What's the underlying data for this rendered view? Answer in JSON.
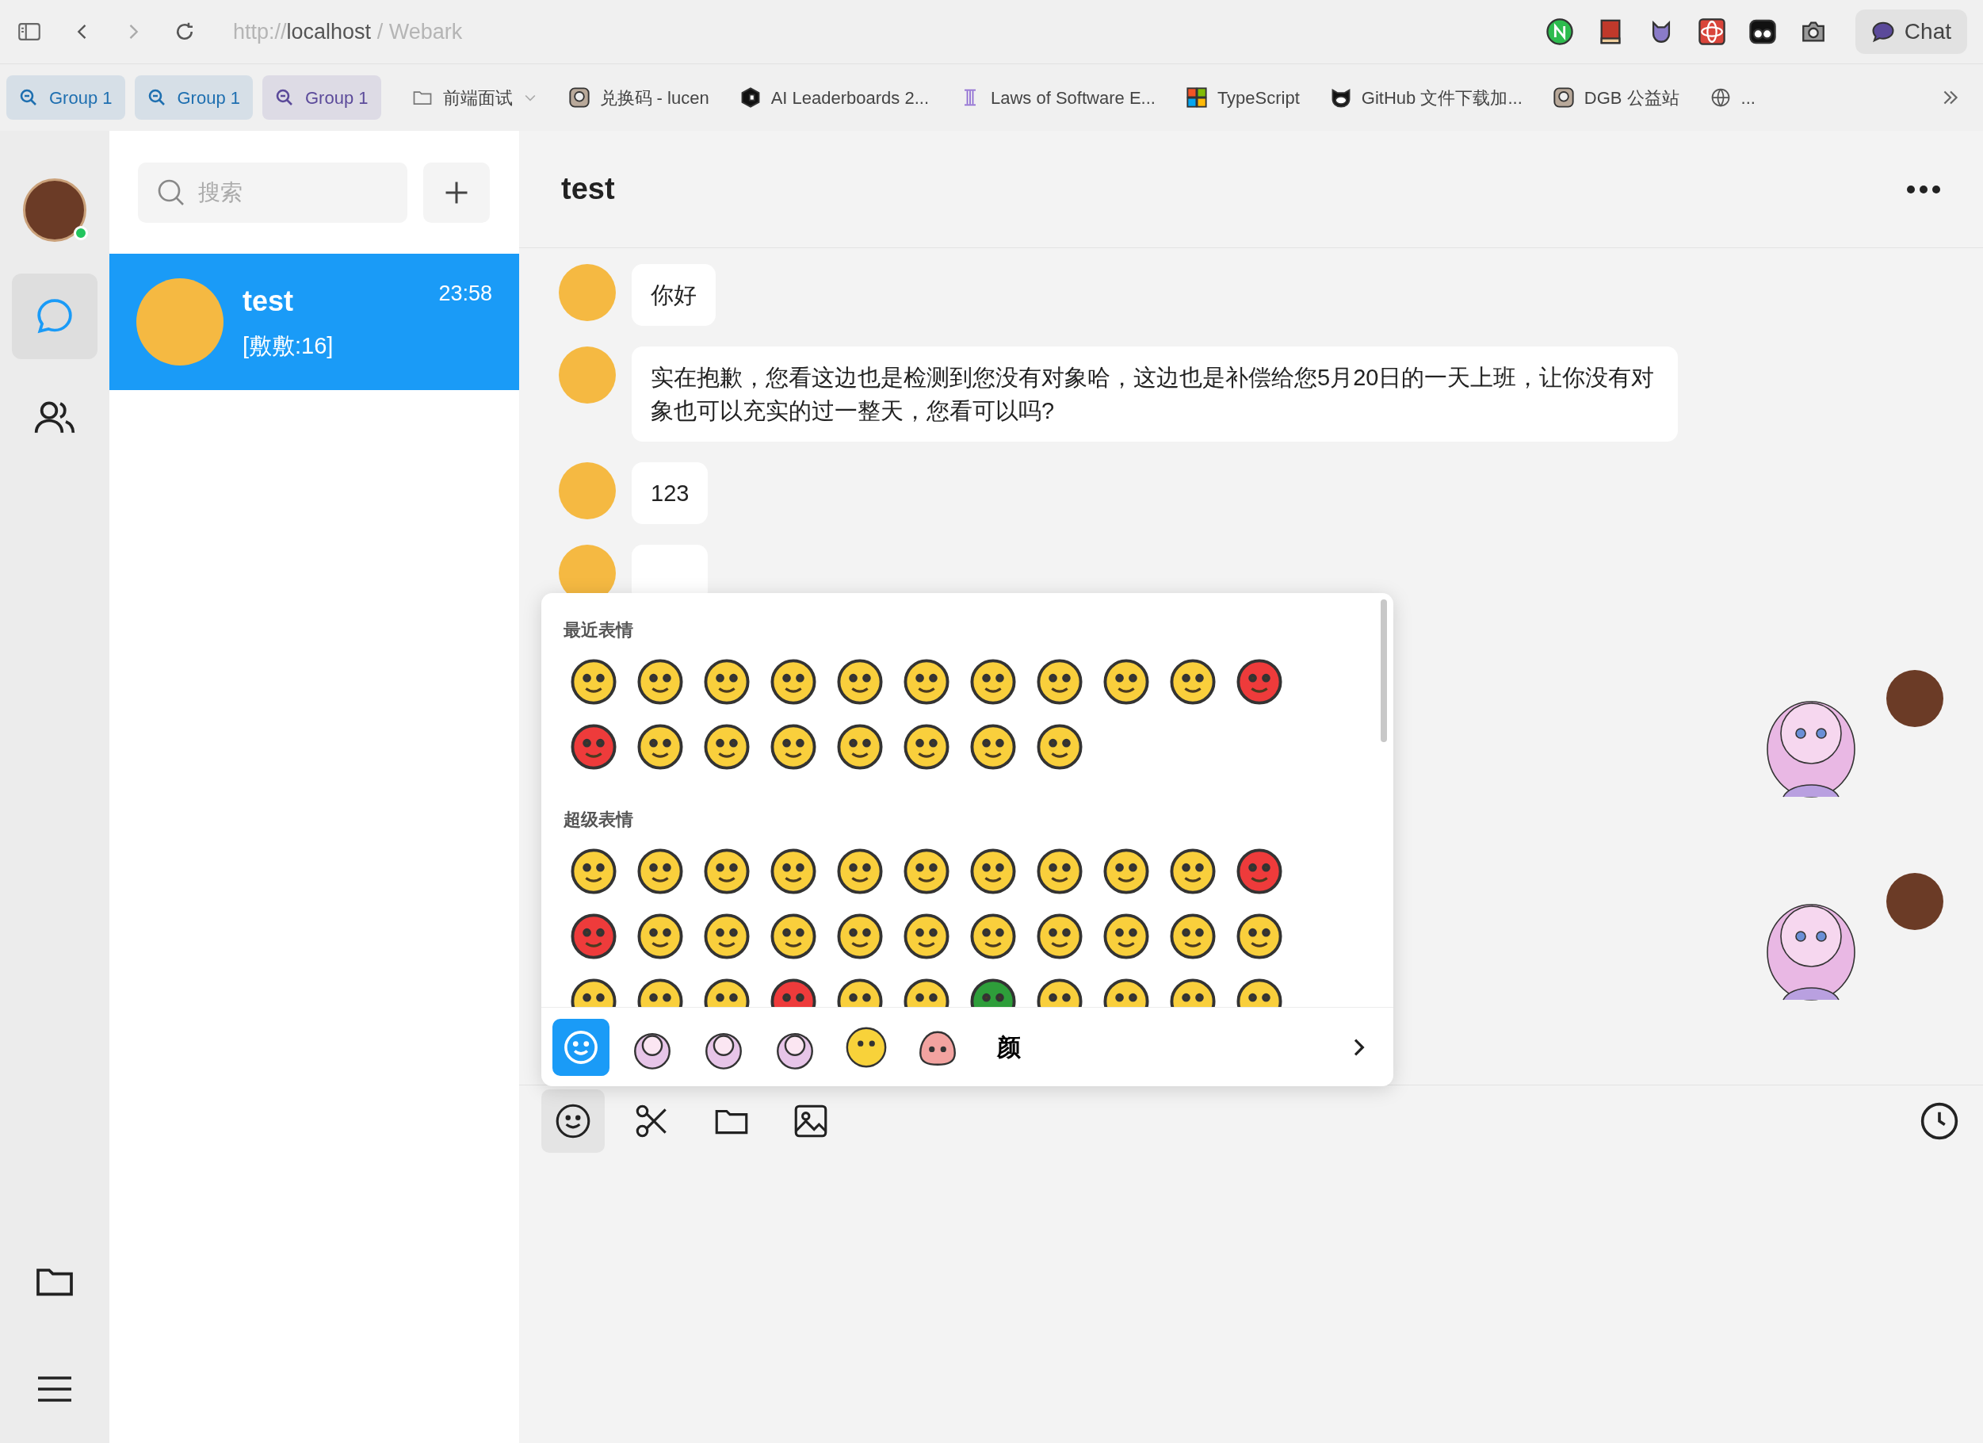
{
  "browser": {
    "url_scheme": "http://",
    "url_host": "localhost",
    "page_title": " / Webark",
    "extensions": [
      {
        "kind": "n"
      },
      {
        "kind": "book"
      },
      {
        "kind": "cat"
      },
      {
        "kind": "atom"
      },
      {
        "kind": "eyes"
      },
      {
        "kind": "camera"
      }
    ],
    "chat_button": "Chat"
  },
  "tab_groups": [
    {
      "label": "Group 1",
      "color": "#1e6fb0"
    },
    {
      "label": "Group 1",
      "color": "#1e6fb0"
    },
    {
      "label": "Group 1",
      "color": "#5b4a9a"
    }
  ],
  "bookmarks": [
    {
      "kind": "folder",
      "label": "前端面试"
    },
    {
      "kind": "image",
      "label": "兑换码 - lucen"
    },
    {
      "kind": "cube",
      "label": "AI Leaderboards 2..."
    },
    {
      "kind": "pillar",
      "label": "Laws of Software E..."
    },
    {
      "kind": "windows",
      "label": "TypeScript"
    },
    {
      "kind": "octocat",
      "label": "GitHub 文件下载加..."
    },
    {
      "kind": "image",
      "label": "DGB 公益站"
    },
    {
      "kind": "globe",
      "label": "..."
    }
  ],
  "sidebar": {
    "online": true,
    "items": [
      {
        "kind": "chat",
        "selected": true
      },
      {
        "kind": "contacts",
        "selected": false
      }
    ],
    "bottom_items": [
      {
        "kind": "folder"
      },
      {
        "kind": "menu"
      }
    ]
  },
  "chat_list": {
    "search": {
      "placeholder": "搜索"
    },
    "conversations": [
      {
        "name": "test",
        "time": "23:58",
        "preview": "[敷敷:16]",
        "selected": true
      }
    ]
  },
  "chat": {
    "title": "test",
    "messages": [
      {
        "outgoing": false,
        "kind": "text",
        "text": "你好"
      },
      {
        "outgoing": false,
        "kind": "text",
        "text": "实在抱歉，您看这边也是检测到您没有对象哈，这边也是补偿给您5月20日的一天上班，让你没有对象也可以充实的过一整天，您看可以吗?"
      },
      {
        "outgoing": false,
        "kind": "text",
        "text": "123"
      },
      {
        "outgoing": false,
        "kind": "covered"
      },
      {
        "outgoing": true,
        "kind": "sticker"
      },
      {
        "outgoing": true,
        "kind": "sticker"
      }
    ]
  },
  "emoji_panel": {
    "sections": [
      {
        "title": "最近表情",
        "emojis": [
          {
            "color": "#f9cf3c"
          },
          {
            "color": "#f9cf3c"
          },
          {
            "color": "#f9cf3c"
          },
          {
            "color": "#f9cf3c"
          },
          {
            "color": "#f9cf3c"
          },
          {
            "color": "#f9cf3c"
          },
          {
            "color": "#f9cf3c"
          },
          {
            "color": "#f9cf3c"
          },
          {
            "color": "#f9cf3c"
          },
          {
            "color": "#f9cf3c"
          },
          {
            "color": "#ee3b3b"
          },
          {
            "color": "#ee3b3b"
          },
          {
            "color": "#f9cf3c"
          },
          {
            "color": "#f9cf3c"
          },
          {
            "color": "#f9cf3c"
          },
          {
            "color": "#f9cf3c"
          },
          {
            "color": "#f9cf3c"
          },
          {
            "color": "#f9cf3c"
          },
          {
            "color": "#f9cf3c"
          }
        ]
      },
      {
        "title": "超级表情",
        "emojis": [
          {
            "color": "#f9cf3c"
          },
          {
            "color": "#f9cf3c"
          },
          {
            "color": "#f9cf3c"
          },
          {
            "color": "#f9cf3c"
          },
          {
            "color": "#f9cf3c"
          },
          {
            "color": "#f9cf3c"
          },
          {
            "color": "#f9cf3c"
          },
          {
            "color": "#f9cf3c"
          },
          {
            "color": "#f9cf3c"
          },
          {
            "color": "#f9cf3c"
          },
          {
            "color": "#ee3b3b"
          },
          {
            "color": "#ee3b3b"
          },
          {
            "color": "#f9cf3c"
          },
          {
            "color": "#f9cf3c"
          },
          {
            "color": "#f9cf3c"
          },
          {
            "color": "#f9cf3c"
          },
          {
            "color": "#f9cf3c"
          },
          {
            "color": "#f9cf3c"
          },
          {
            "color": "#f9cf3c"
          },
          {
            "color": "#f9cf3c"
          },
          {
            "color": "#f9cf3c"
          },
          {
            "color": "#f9cf3c"
          },
          {
            "color": "#f9cf3c"
          },
          {
            "color": "#f9cf3c"
          },
          {
            "color": "#f9cf3c"
          },
          {
            "color": "#ee3b3b"
          },
          {
            "color": "#f9cf3c"
          },
          {
            "color": "#f9cf3c"
          },
          {
            "color": "#2e9e3a"
          },
          {
            "color": "#f9cf3c"
          },
          {
            "color": "#f9cf3c"
          },
          {
            "color": "#f9cf3c"
          },
          {
            "color": "#f9cf3c"
          }
        ]
      }
    ],
    "tabs": [
      {
        "kind": "smiley",
        "selected": true
      },
      {
        "kind": "sticker",
        "selected": false
      },
      {
        "kind": "sticker",
        "selected": false
      },
      {
        "kind": "sticker",
        "selected": false
      },
      {
        "kind": "face",
        "selected": false
      },
      {
        "kind": "peach",
        "selected": false
      },
      {
        "kind": "text",
        "label": "颜",
        "selected": false
      }
    ]
  },
  "input_toolbar": {
    "tools": [
      {
        "kind": "emoji",
        "selected": true
      },
      {
        "kind": "scissors",
        "selected": false
      },
      {
        "kind": "folder",
        "selected": false
      },
      {
        "kind": "image",
        "selected": false
      }
    ]
  }
}
